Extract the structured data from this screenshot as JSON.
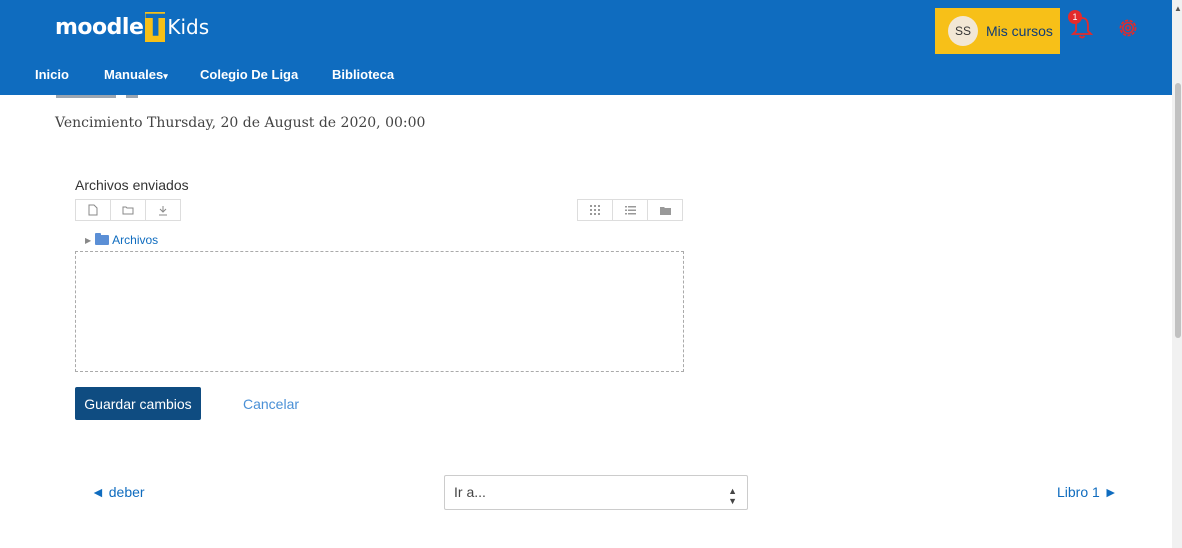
{
  "logo": {
    "word": "moodle",
    "letter": "T",
    "suffix": "Kids"
  },
  "user": {
    "initials": "SS",
    "menu_label": "Mis cursos",
    "notification_count": "1"
  },
  "nav": [
    {
      "label": "Inicio"
    },
    {
      "label": "Manuales"
    },
    {
      "label": "Colegio De Liga"
    },
    {
      "label": "Biblioteca"
    }
  ],
  "assignment": {
    "due": "Vencimiento Thursday, 20 de August de 2020, 00:00"
  },
  "files": {
    "title": "Archivos enviados",
    "folder": "Archivos"
  },
  "actions": {
    "save": "Guardar cambios",
    "cancel": "Cancelar"
  },
  "pager": {
    "prev": "◄ deber",
    "jump_placeholder": "Ir a...",
    "next": "Libro 1 ►"
  },
  "colors": {
    "header": "#0f6cbf",
    "accent": "#f7c018",
    "button": "#0f4c81",
    "badge": "#e32b2b"
  },
  "icons": [
    "bell-icon",
    "gear-icon",
    "new-file-icon",
    "new-folder-icon",
    "download-icon",
    "grid-view-icon",
    "list-view-icon",
    "tree-view-icon",
    "folder-icon"
  ]
}
